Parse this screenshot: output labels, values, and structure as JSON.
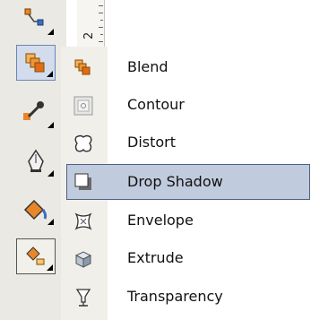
{
  "ruler": {
    "label": "2"
  },
  "toolbox": {
    "tools": [
      {
        "icon": "connector-tool-icon"
      },
      {
        "icon": "blend-tool-icon",
        "active": true
      },
      {
        "icon": "eyedropper-tool-icon"
      },
      {
        "icon": "outline-pen-tool-icon"
      },
      {
        "icon": "fill-tool-icon"
      },
      {
        "icon": "interactive-fill-tool-icon"
      }
    ]
  },
  "menu": {
    "items": [
      {
        "label": "Blend",
        "icon": "blend-icon"
      },
      {
        "label": "Contour",
        "icon": "contour-icon"
      },
      {
        "label": "Distort",
        "icon": "distort-icon"
      },
      {
        "label": "Drop Shadow",
        "icon": "drop-shadow-icon",
        "selected": true
      },
      {
        "label": "Envelope",
        "icon": "envelope-icon"
      },
      {
        "label": "Extrude",
        "icon": "extrude-icon"
      },
      {
        "label": "Transparency",
        "icon": "transparency-icon"
      }
    ]
  },
  "colors": {
    "toolbox_bg": "#ebe9e3",
    "selection_bg": "#c1cbde",
    "selection_border": "#4d6185",
    "orange": "#e8862a",
    "blue": "#3a6ec4"
  }
}
